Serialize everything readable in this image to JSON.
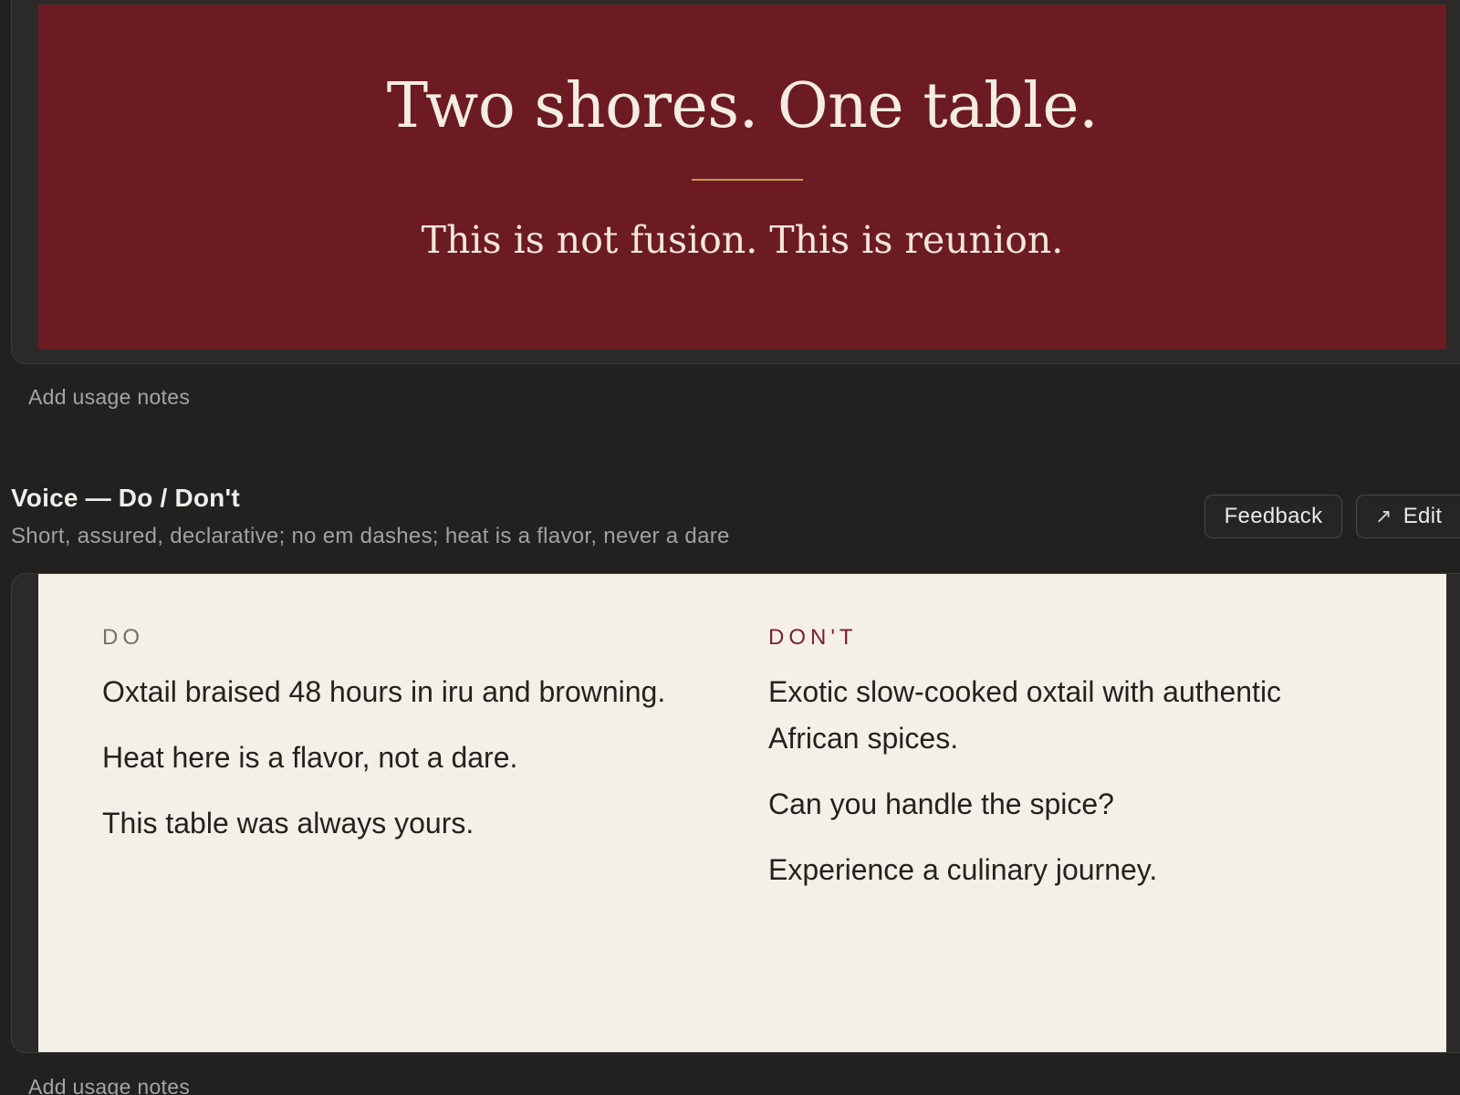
{
  "hero": {
    "title": "Two shores. One table.",
    "subtitle": "This is not fusion. This is reunion.",
    "background_color": "#6c1b22",
    "accent_rule_color": "#c79a4a"
  },
  "hero_usage_note": "Add usage notes",
  "voice_section": {
    "title": "Voice — Do / Don't",
    "description": "Short, assured, declarative; no em dashes; heat is a flavor, never a dare",
    "feedback_label": "Feedback",
    "edit_label": "Edit",
    "edit_icon": "arrow-up-right-icon",
    "do": {
      "heading": "DO",
      "items": [
        "Oxtail braised 48 hours in iru and browning.",
        "Heat here is a flavor, not a dare.",
        "This table was always yours."
      ]
    },
    "dont": {
      "heading": "DON'T",
      "items": [
        "Exotic slow-cooked oxtail with authentic African spices.",
        "Can you handle the spice?",
        "Experience a culinary journey."
      ]
    },
    "panel_color": "#f4f0e8",
    "do_color": "#6f7360",
    "dont_color": "#7d1f28"
  },
  "voice_usage_note": "Add usage notes"
}
